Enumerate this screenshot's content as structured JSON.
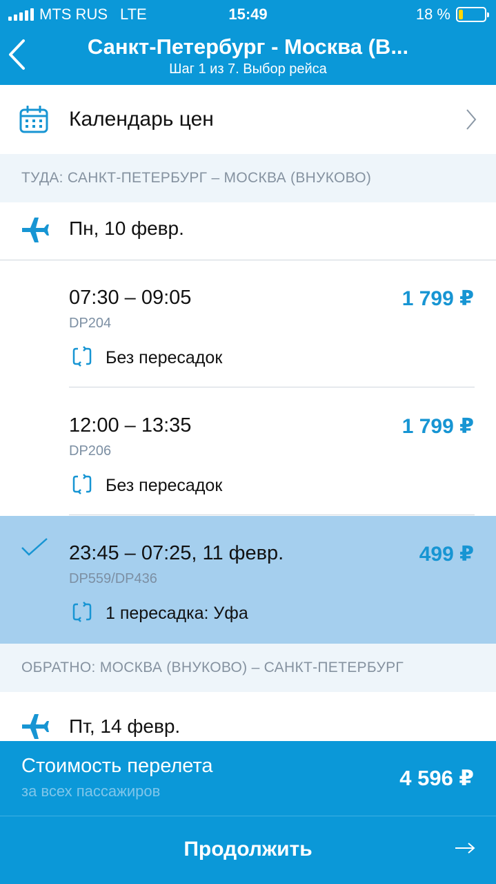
{
  "status_bar": {
    "carrier": "MTS RUS",
    "network": "LTE",
    "time": "15:49",
    "battery_percent": "18 %",
    "battery_level": 0.18
  },
  "header": {
    "title": "Санкт-Петербург - Москва (В...",
    "subtitle": "Шаг 1 из 7. Выбор рейса"
  },
  "calendar": {
    "label": "Календарь цен"
  },
  "outbound": {
    "section_title": "ТУДА: САНКТ-ПЕТЕРБУРГ – МОСКВА (ВНУКОВО)",
    "date": "Пн, 10 февр.",
    "flights": [
      {
        "time": "07:30 – 09:05",
        "number": "DP204",
        "price": "1 799 ₽",
        "transfer": "Без пересадок",
        "selected": false
      },
      {
        "time": "12:00 – 13:35",
        "number": "DP206",
        "price": "1 799 ₽",
        "transfer": "Без пересадок",
        "selected": false
      },
      {
        "time": "23:45 – 07:25, 11 февр.",
        "number": "DP559/DP436",
        "price": "499 ₽",
        "transfer": "1 пересадка: Уфа",
        "selected": true
      }
    ]
  },
  "return": {
    "section_title": "ОБРАТНО: МОСКВА (ВНУКОВО) – САНКТ-ПЕТЕРБУРГ",
    "date": "Пт, 14 февр."
  },
  "summary": {
    "title": "Стоимость перелета",
    "subtitle": "за всех пассажиров",
    "total": "4 596 ₽"
  },
  "continue_button": {
    "label": "Продолжить"
  },
  "colors": {
    "brand": "#0b98d8",
    "price": "#1795d3",
    "selected_row": "#a5cfee",
    "section_bg": "#eef5fa"
  }
}
